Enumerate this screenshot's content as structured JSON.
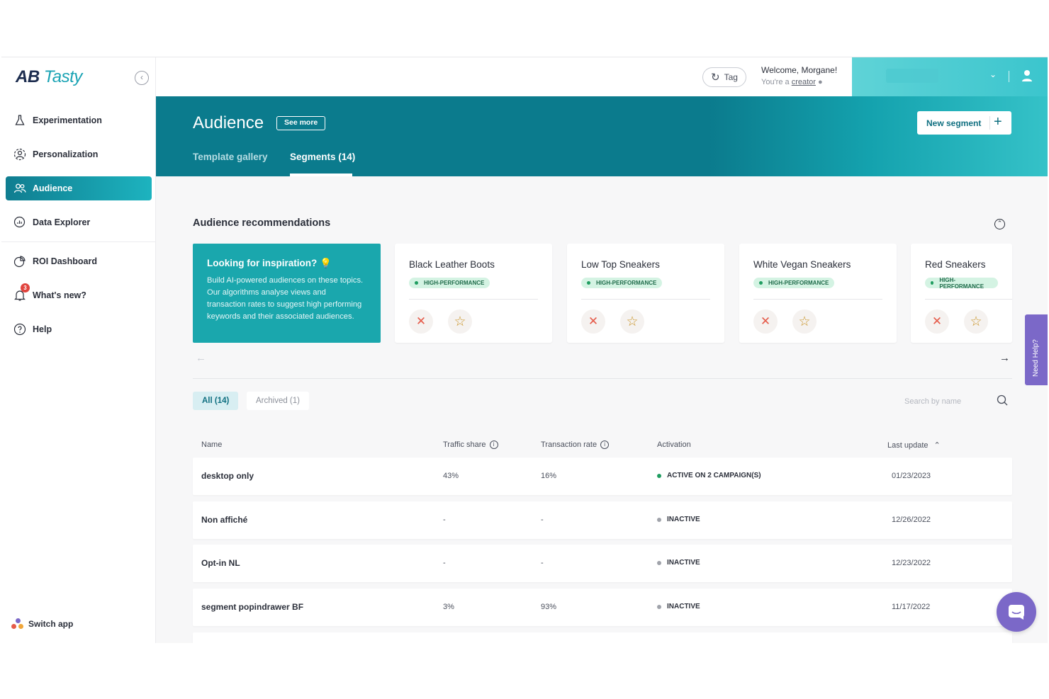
{
  "app": {
    "logo_ab": "AB",
    "logo_tasty": "Tasty"
  },
  "sidebar": {
    "items": [
      {
        "label": "Experimentation",
        "icon": "flask-icon"
      },
      {
        "label": "Personalization",
        "icon": "user-circle-icon"
      },
      {
        "label": "Audience",
        "icon": "users-icon",
        "active": true
      },
      {
        "label": "Data Explorer",
        "icon": "chart-search-icon"
      },
      {
        "label": "ROI Dashboard",
        "icon": "pie-chart-icon"
      },
      {
        "label": "What's new?",
        "icon": "bell-icon",
        "badge": "3"
      },
      {
        "label": "Help",
        "icon": "question-circle-icon"
      }
    ],
    "switch_app": "Switch app"
  },
  "topbar": {
    "tag_label": "Tag",
    "welcome": "Welcome, Morgane!",
    "role_prefix": "You're a",
    "role": "creator"
  },
  "header": {
    "title": "Audience",
    "see_more": "See more",
    "tabs": [
      {
        "label": "Template gallery",
        "active": false
      },
      {
        "label": "Segments (14)",
        "active": true
      }
    ],
    "new_segment": "New segment"
  },
  "recommendations": {
    "title": "Audience recommendations",
    "inspiration_title": "Looking for inspiration?",
    "inspiration_text": "Build AI-powered audiences on these topics. Our algorithms analyse views and transaction rates to suggest high performing keywords and their associated audiences.",
    "cards": [
      {
        "name": "Black Leather Boots",
        "badge": "HIGH-PERFORMANCE"
      },
      {
        "name": "Low Top Sneakers",
        "badge": "HIGH-PERFORMANCE"
      },
      {
        "name": "White Vegan Sneakers",
        "badge": "HIGH-PERFORMANCE"
      },
      {
        "name": "Red Sneakers",
        "badge": "HIGH-PERFORMANCE"
      }
    ]
  },
  "filters": {
    "all": "All (14)",
    "archived": "Archived (1)",
    "search_placeholder": "Search by name"
  },
  "table": {
    "columns": [
      "Name",
      "Traffic share",
      "Transaction rate",
      "Activation",
      "Last update"
    ],
    "rows": [
      {
        "name": "desktop only",
        "traffic": "43%",
        "transaction": "16%",
        "activation": "ACTIVE ON 2 CAMPAIGN(S)",
        "status": "active",
        "updated": "01/23/2023"
      },
      {
        "name": "Non affiché",
        "traffic": "-",
        "transaction": "-",
        "activation": "INACTIVE",
        "status": "inactive",
        "updated": "12/26/2022"
      },
      {
        "name": "Opt-in NL",
        "traffic": "-",
        "transaction": "-",
        "activation": "INACTIVE",
        "status": "inactive",
        "updated": "12/23/2022"
      },
      {
        "name": "segment popindrawer BF",
        "traffic": "3%",
        "transaction": "93%",
        "activation": "INACTIVE",
        "status": "inactive",
        "updated": "11/17/2022"
      }
    ]
  },
  "floating": {
    "need_help": "Need Help?"
  },
  "colors": {
    "brand_teal": "#0b7b8d",
    "accent_teal": "#1aa7ad",
    "active_dot": "#1f9d60",
    "inactive_dot": "#a0a3aa",
    "purple": "#7b68c8"
  }
}
